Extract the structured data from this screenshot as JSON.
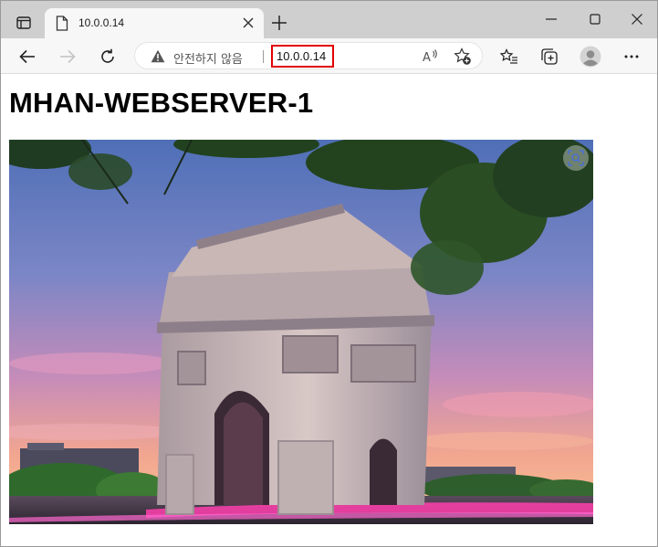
{
  "browser": {
    "tab": {
      "title": "10.0.0.14",
      "favicon": "page-icon"
    },
    "toolbar": {
      "security_text": "안전하지 않음",
      "url": "10.0.0.14"
    }
  },
  "page": {
    "heading": "MHAN-WEBSERVER-1"
  },
  "colors": {
    "url_highlight": "#e10000",
    "tabstrip_bg": "#cfcfcf",
    "toolbar_bg": "#f7f7f7"
  }
}
